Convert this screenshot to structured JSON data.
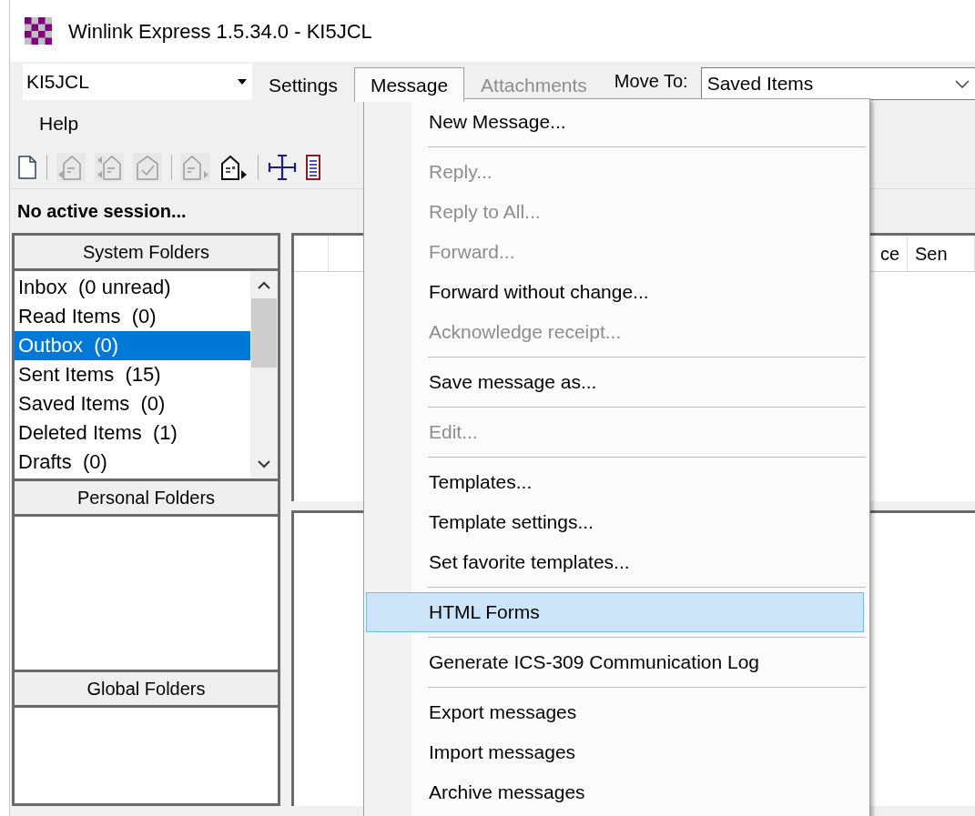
{
  "window": {
    "title": "Winlink Express 1.5.34.0 - KI5JCL"
  },
  "menubar": {
    "callsign": "KI5JCL",
    "items": [
      {
        "label": "Settings",
        "selected": false,
        "disabled": false
      },
      {
        "label": "Message",
        "selected": true,
        "disabled": false
      },
      {
        "label": "Attachments",
        "selected": false,
        "disabled": true
      }
    ],
    "move_to_label": "Move To:",
    "move_to_value": "Saved Items",
    "help": "Help"
  },
  "status": "No active session...",
  "system_folders": {
    "title": "System Folders",
    "items": [
      {
        "label": "Inbox  (0 unread)",
        "selected": false
      },
      {
        "label": "Read Items  (0)",
        "selected": false
      },
      {
        "label": "Outbox  (0)",
        "selected": true
      },
      {
        "label": "Sent Items  (15)",
        "selected": false
      },
      {
        "label": "Saved Items  (0)",
        "selected": false
      },
      {
        "label": "Deleted Items  (1)",
        "selected": false
      },
      {
        "label": "Drafts  (0)",
        "selected": false
      }
    ]
  },
  "personal_folders": {
    "title": "Personal Folders"
  },
  "global_folders": {
    "title": "Global Folders"
  },
  "message_list": {
    "columns": [
      "",
      "",
      "ce",
      "Sen"
    ]
  },
  "message_menu": {
    "sections": [
      [
        {
          "label": "New Message...",
          "disabled": false,
          "selected": false
        }
      ],
      [
        {
          "label": "Reply...",
          "disabled": true,
          "selected": false
        },
        {
          "label": "Reply to All...",
          "disabled": true,
          "selected": false
        },
        {
          "label": "Forward...",
          "disabled": true,
          "selected": false
        },
        {
          "label": "Forward without change...",
          "disabled": false,
          "selected": false
        },
        {
          "label": "Acknowledge receipt...",
          "disabled": true,
          "selected": false
        }
      ],
      [
        {
          "label": "Save message as...",
          "disabled": false,
          "selected": false
        }
      ],
      [
        {
          "label": "Edit...",
          "disabled": true,
          "selected": false
        }
      ],
      [
        {
          "label": "Templates...",
          "disabled": false,
          "selected": false
        },
        {
          "label": "Template settings...",
          "disabled": false,
          "selected": false
        },
        {
          "label": "Set favorite templates...",
          "disabled": false,
          "selected": false
        }
      ],
      [
        {
          "label": "HTML Forms",
          "disabled": false,
          "selected": true
        }
      ],
      [
        {
          "label": "Generate ICS-309 Communication Log",
          "disabled": false,
          "selected": false
        }
      ],
      [
        {
          "label": "Export messages",
          "disabled": false,
          "selected": false
        },
        {
          "label": "Import messages",
          "disabled": false,
          "selected": false
        },
        {
          "label": "Archive messages",
          "disabled": false,
          "selected": false
        }
      ]
    ]
  }
}
